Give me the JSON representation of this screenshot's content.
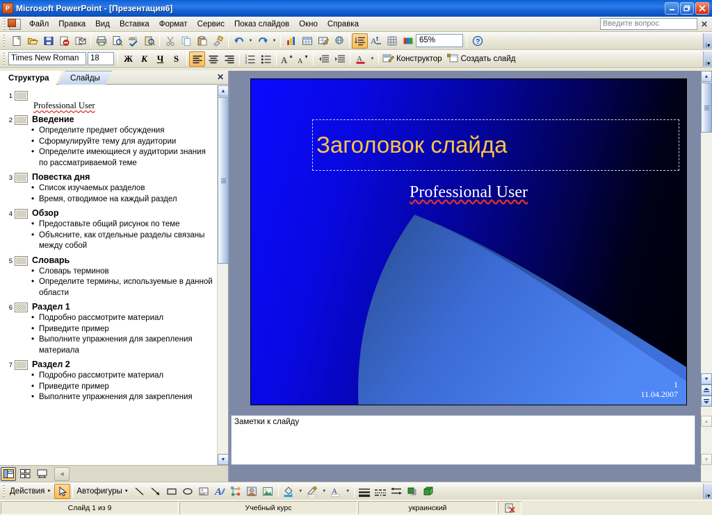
{
  "window": {
    "title": "Microsoft PowerPoint - [Презентация6]",
    "app_icon": "powerpoint-icon",
    "minimize": "_",
    "restore": "❐",
    "close": "✕"
  },
  "menubar": {
    "items": [
      "Файл",
      "Правка",
      "Вид",
      "Вставка",
      "Формат",
      "Сервис",
      "Показ слайдов",
      "Окно",
      "Справка"
    ],
    "question_placeholder": "Введите вопрос",
    "question_value": "",
    "close_label": "✕"
  },
  "standard_toolbar": {
    "buttons": [
      "new-icon",
      "open-icon",
      "save-icon",
      "permission-icon",
      "email-icon",
      "print-icon",
      "print-preview-icon",
      "spelling-icon",
      "research-icon",
      "cut-icon",
      "copy-icon",
      "paste-icon",
      "format-painter-icon",
      "undo-icon",
      "redo-icon",
      "chart-icon",
      "table-icon",
      "table-draw-icon",
      "hyperlink-icon",
      "expand-all-icon",
      "show-formatting-icon",
      "grid-icon",
      "color-scheme-icon"
    ],
    "zoom_value": "65%",
    "help_icon": "help-icon",
    "overflow": "toolbar-options-icon"
  },
  "formatting_toolbar": {
    "font_name": "Times New Roman",
    "font_size": "18",
    "bold_label": "Ж",
    "italic_label": "К",
    "underline_label": "Ч",
    "shadow_label": "S",
    "align_left": "align-left-icon",
    "align_center": "align-center-icon",
    "align_right": "align-right-icon",
    "numbering": "numbering-icon",
    "bullets": "bullets-icon",
    "increase_font": "increase-font-icon",
    "decrease_font": "decrease-font-icon",
    "decrease_indent": "decrease-indent-icon",
    "increase_indent": "increase-indent-icon",
    "font_color": "font-color-icon",
    "design_label": "Конструктор",
    "new_slide_label": "Создать слайд",
    "overflow": "toolbar-options-icon"
  },
  "outline_pane": {
    "tab_outline": "Структура",
    "tab_slides": "Слайды",
    "close_label": "✕",
    "slides": [
      {
        "number": "1",
        "title": "",
        "plain": "Professional User",
        "bullets": []
      },
      {
        "number": "2",
        "title": "Введение",
        "bullets": [
          "Определите предмет обсуждения",
          "Сформулируйте тему для аудитории",
          "Определите имеющиеся у аудитории знания по рассматриваемой теме"
        ]
      },
      {
        "number": "3",
        "title": "Повестка дня",
        "bullets": [
          "Список изучаемых разделов",
          "Время, отводимое на каждый раздел"
        ]
      },
      {
        "number": "4",
        "title": "Обзор",
        "bullets": [
          "Предоставьте общий рисунок по теме",
          "Объясните, как отдельные разделы связаны между собой"
        ]
      },
      {
        "number": "5",
        "title": "Словарь",
        "bullets": [
          "Словарь терминов",
          "Определите термины, используемые в данной области"
        ]
      },
      {
        "number": "6",
        "title": "Раздел 1",
        "bullets": [
          "Подробно рассмотрите материал",
          "Приведите пример",
          "Выполните упражнения для закрепления материала"
        ]
      },
      {
        "number": "7",
        "title": "Раздел 2",
        "bullets": [
          "Подробно рассмотрите материал",
          "Приведите пример",
          "Выполните упражнения для закрепления"
        ]
      }
    ],
    "view_buttons": [
      "normal-view-icon",
      "slide-sorter-icon",
      "slide-show-icon"
    ]
  },
  "slide": {
    "title": "Заголовок слайда",
    "subtitle": "Professional User",
    "slide_number": "1",
    "date": "11.04.2007",
    "colors": {
      "gradient_light": "#0b0bff",
      "gradient_dark": "#000006",
      "title_color": "#ffc446",
      "swoosh_light": "#4a7ff0",
      "swoosh_dark": "#2a4c8f"
    }
  },
  "notes": {
    "placeholder": "Заметки к слайду"
  },
  "drawing_toolbar": {
    "actions_label": "Действия",
    "select_icon": "select-arrow-icon",
    "autoshapes_label": "Автофигуры",
    "tools": [
      "line-icon",
      "arrow-icon",
      "rectangle-icon",
      "oval-icon",
      "textbox-icon",
      "wordart-icon",
      "diagram-icon",
      "clipart-icon",
      "picture-icon",
      "fill-color-icon",
      "line-color-icon",
      "font-color-icon",
      "line-style-icon",
      "dash-style-icon",
      "arrow-style-icon",
      "shadow-style-icon",
      "3d-style-icon"
    ],
    "overflow": "toolbar-options-icon"
  },
  "statusbar": {
    "slide_info": "Слайд 1 из 9",
    "design_name": "Учебный курс",
    "language": "украинский",
    "spell_icon": "spelling-status-icon"
  }
}
